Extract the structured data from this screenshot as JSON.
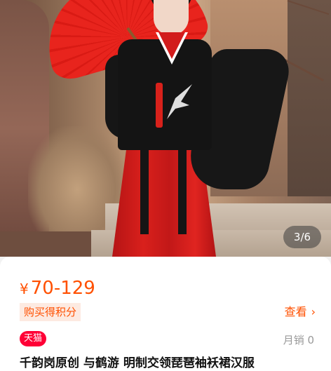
{
  "gallery": {
    "page_indicator": "3/6"
  },
  "product": {
    "currency_symbol": "¥",
    "price_range": "70-129",
    "points_tag": "购买得积分",
    "view_link": "查看",
    "view_link_icon": "chevron-right-icon",
    "store_badge": "天猫",
    "monthly_sales": "月销 0",
    "title": "千韵岗原创 与鹤游 明制交领琵琶袖袄裙汉服"
  },
  "colors": {
    "price_accent": "#ff5000",
    "tmall_red": "#ff0036",
    "points_tag_bg": "#fdeae1",
    "muted_text": "#999999"
  }
}
